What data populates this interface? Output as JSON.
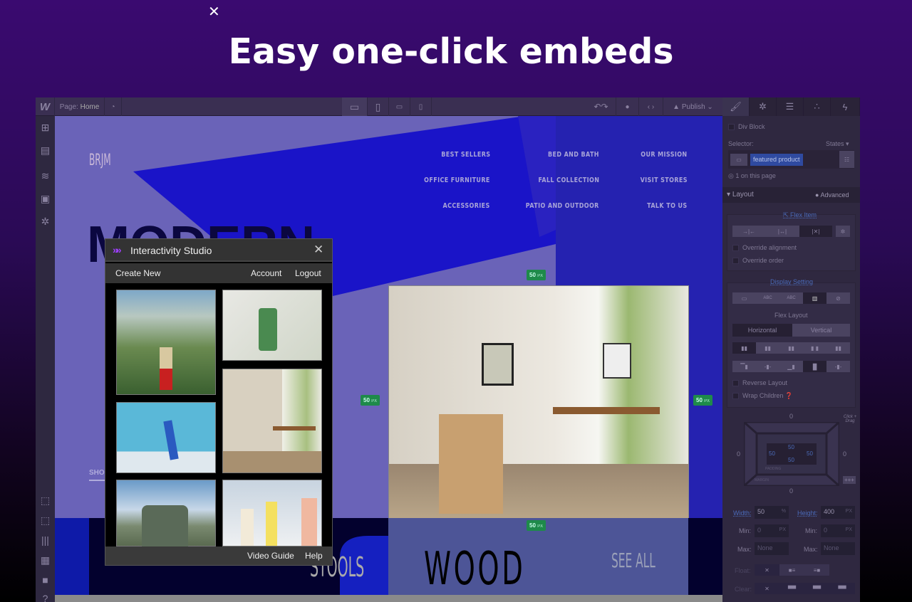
{
  "overlay": {
    "close_icon": "close-icon",
    "title": "Easy one-click embeds"
  },
  "topbar": {
    "logo": "W",
    "page_label": "Page:",
    "page_name": "Home",
    "publish": "Publish"
  },
  "site": {
    "logo": "BRJM",
    "hero_partial": "MODERN",
    "nav": [
      "BEST SELLERS",
      "BED AND BATH",
      "OUR MISSION",
      "OFFICE FURNITURE",
      "FALL COLLECTION",
      "VISIT STORES",
      "ACCESSORIES",
      "PATIO AND OUTDOOR",
      "TALK TO US"
    ],
    "shop_partial": "SHOP",
    "stools": "STOOLS",
    "wood": "WOOD",
    "see_all": "SEE ALL",
    "margin_badge": {
      "value": "50",
      "unit": "PX"
    }
  },
  "modal": {
    "title": "Interactivity Studio",
    "create_new": "Create New",
    "account": "Account",
    "logout": "Logout",
    "video_guide": "Video Guide",
    "help": "Help",
    "accent": "#a040ff"
  },
  "panel": {
    "element": "Div Block",
    "selector_label": "Selector:",
    "states": "States",
    "selector_value": "featured product",
    "on_page": "1 on this page",
    "layout": "Layout",
    "advanced": "Advanced",
    "flex_item": "Flex Item",
    "override_alignment": "Override alignment",
    "override_order": "Override order",
    "display_setting": "Display Setting",
    "abc": "ABC",
    "flex_layout": "Flex Layout",
    "horizontal": "Horizontal",
    "vertical": "Vertical",
    "reverse_layout": "Reverse Layout",
    "wrap_children": "Wrap Children",
    "margin_top": "0",
    "margin_left": "0",
    "margin_right": "0",
    "margin_bottom": "0",
    "padding_top": "50",
    "padding_left": "50",
    "padding_right": "50",
    "padding_bottom": "50",
    "padding_label": "PADDING",
    "margin_label": "MARGIN",
    "click_drag": "Click + Drag",
    "width_label": "Width:",
    "width": "50",
    "width_unit": "%",
    "height_label": "Height:",
    "height": "400",
    "height_unit": "PX",
    "min_label": "Min:",
    "min_w": "0",
    "min_h": "0",
    "px": "PX",
    "max_label": "Max:",
    "max_w": "None",
    "max_h": "None",
    "float_label": "Float:",
    "clear_label": "Clear:",
    "x": "✕"
  }
}
